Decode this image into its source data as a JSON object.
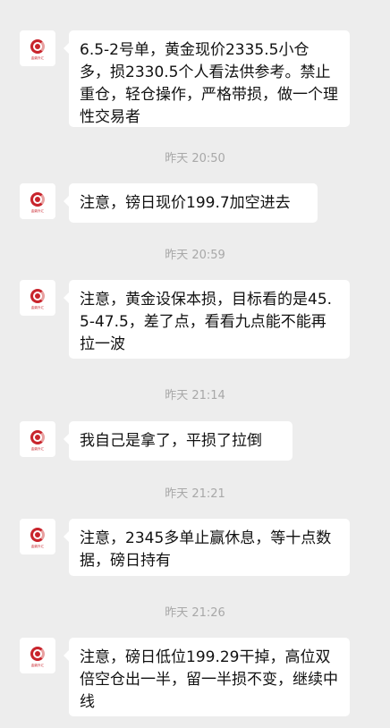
{
  "chat": {
    "avatar_logo_text": "金鼎外汇",
    "messages": [
      {
        "text": "6.5-2号单，黄金现价2335.5小仓多，损2330.5个人看法供参考。禁止重仓，轻仓操作，严格带损，做一个理性交易者"
      },
      {
        "time": "昨天 20:50"
      },
      {
        "text": "注意，镑日现价199.7加空进去"
      },
      {
        "time": "昨天 20:59"
      },
      {
        "text": "注意，黄金设保本损，目标看的是45.5-47.5，差了点，看看九点能不能再拉一波"
      },
      {
        "time": "昨天 21:14"
      },
      {
        "text": "我自己是拿了，平损了拉倒"
      },
      {
        "time": "昨天 21:21"
      },
      {
        "text": "注意，2345多单止赢休息，等十点数据，磅日持有"
      },
      {
        "time": "昨天 21:26"
      },
      {
        "text": "注意，磅日低位199.29干掉，高位双倍空仓出一半，留一半损不变，继续中线"
      }
    ]
  }
}
